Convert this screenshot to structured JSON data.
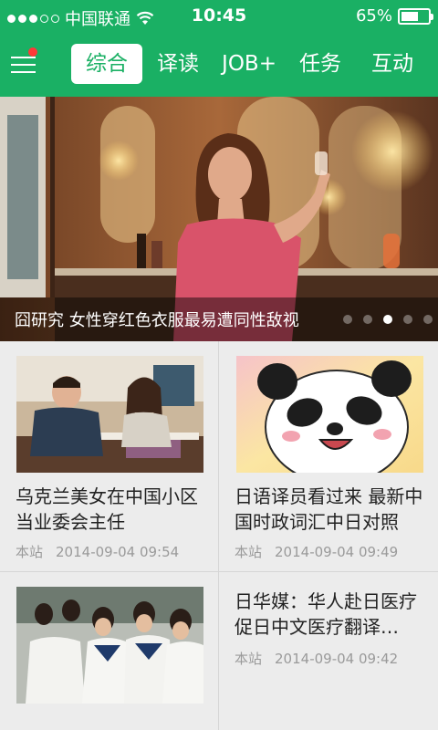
{
  "status_bar": {
    "carrier": "中国联通",
    "time": "10:45",
    "battery": "65%",
    "battery_level": 0.65
  },
  "nav": {
    "tabs": [
      {
        "label": "综合",
        "active": true
      },
      {
        "label": "译读",
        "active": false
      },
      {
        "label": "JOB+",
        "active": false
      },
      {
        "label": "任务",
        "active": false
      },
      {
        "label": "互动",
        "active": false
      }
    ],
    "menu_icon": "hamburger-menu-icon",
    "notification_dot_color": "#ff3838"
  },
  "banner": {
    "title": "囧研究 女性穿红色衣服最易遭同性敌视",
    "slide_count": 5,
    "active_slide": 3
  },
  "articles": [
    {
      "title": "乌克兰美女在中国小区当业委会主任",
      "source": "本站",
      "date": "2014-09-04 09:54"
    },
    {
      "title": "日语译员看过来 最新中国时政词汇中日对照",
      "source": "本站",
      "date": "2014-09-04 09:49"
    },
    {
      "title": "日华媒：华人赴日医疗促日中文医疗翻译…",
      "source": "本站",
      "date": "2014-09-04 09:42"
    }
  ],
  "colors": {
    "brand_green": "#1ab064",
    "background": "#ececec",
    "meta_gray": "#9a9a9a"
  }
}
